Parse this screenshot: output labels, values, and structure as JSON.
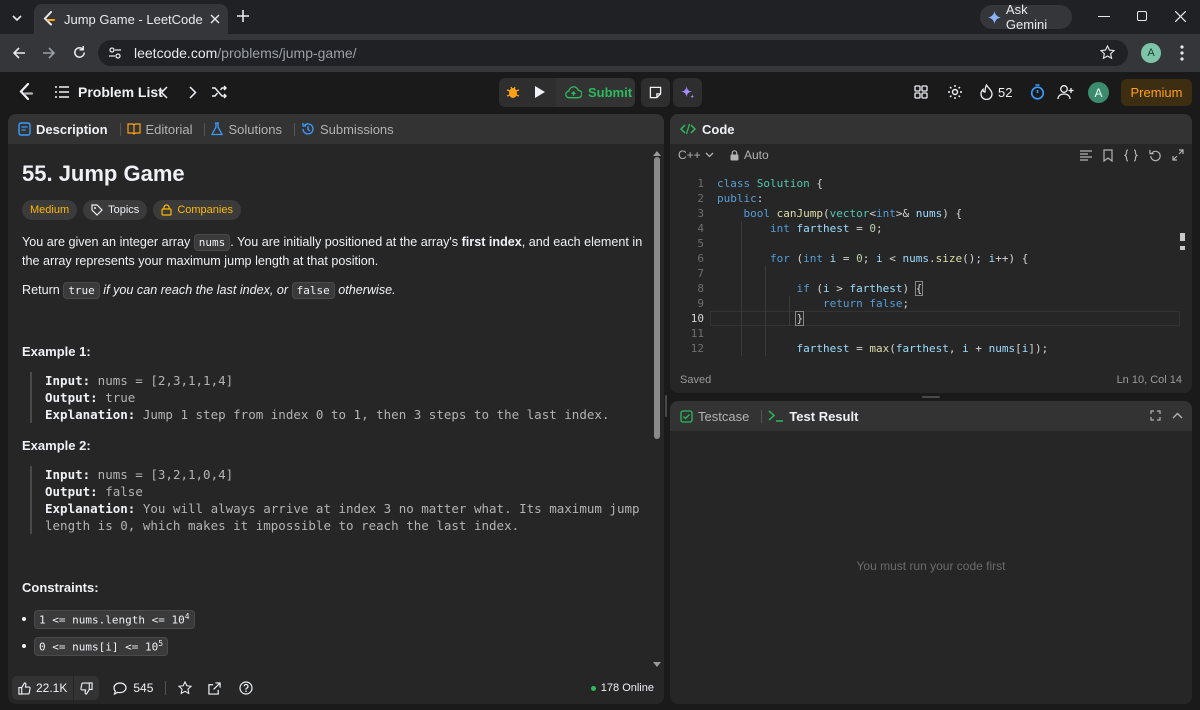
{
  "browser": {
    "tab_title": "Jump Game - LeetCode",
    "url_host": "leetcode.com",
    "url_path": "/problems/jump-game/",
    "ask_gemini": "Ask Gemini",
    "profile_initial": "A"
  },
  "nav": {
    "problem_list": "Problem List",
    "submit": "Submit",
    "streak": "52",
    "avatar": "A",
    "premium": "Premium"
  },
  "left_tabs": [
    "Description",
    "Editorial",
    "Solutions",
    "Submissions"
  ],
  "problem": {
    "title": "55. Jump Game",
    "difficulty": "Medium",
    "topics": "Topics",
    "companies": "Companies",
    "p1_a": "You are given an integer array ",
    "p1_code": "nums",
    "p1_b": ". You are initially positioned at the array's ",
    "p1_bold": "first index",
    "p1_c": ", and each element in the array represents your maximum jump length at that position.",
    "p2_a": "Return ",
    "p2_true": "true",
    "p2_b": " if you can reach the last index, or ",
    "p2_false": "false",
    "p2_c": " otherwise.",
    "ex1_title": "Example 1:",
    "ex1_input_label": "Input:",
    "ex1_input": " nums = [2,3,1,1,4]",
    "ex1_output_label": "Output:",
    "ex1_output": " true",
    "ex1_expl_label": "Explanation:",
    "ex1_expl": " Jump 1 step from index 0 to 1, then 3 steps to the last index.",
    "ex2_title": "Example 2:",
    "ex2_input_label": "Input:",
    "ex2_input": " nums = [3,2,1,0,4]",
    "ex2_output_label": "Output:",
    "ex2_output": " false",
    "ex2_expl_label": "Explanation:",
    "ex2_expl_1": " You will always arrive at index 3 no matter what. Its maximum jump",
    "ex2_expl_2": "length is 0, which makes it impossible to reach the last index.",
    "constraints_title": "Constraints:",
    "c1": "1 <= nums.length <= 10",
    "c1_sup": "4",
    "c2": "0 <= nums[i] <= 10",
    "c2_sup": "5"
  },
  "footer": {
    "likes": "22.1K",
    "comments": "545",
    "online": "178 Online"
  },
  "editor": {
    "title": "Code",
    "language": "C++",
    "mode": "Auto",
    "saved": "Saved",
    "cursor": "Ln 10, Col 14",
    "current_line": 10
  },
  "bottom": {
    "testcase": "Testcase",
    "test_result": "Test Result",
    "empty": "You must run your code first"
  },
  "colors": {
    "accent_green": "#2cbb5d",
    "medium": "#ffb800",
    "premium_bg": "#3d2e12",
    "premium_text": "#ffa116"
  }
}
